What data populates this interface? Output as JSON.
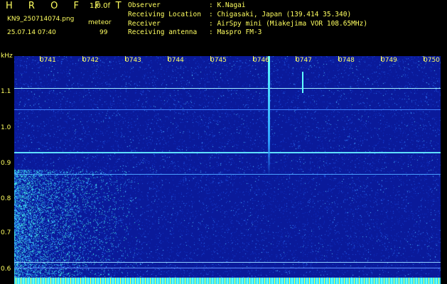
{
  "header": {
    "title": "H R O F F T",
    "version": "1.0.0f",
    "filename": "KN9_250714074.png",
    "mode": "meteor",
    "datetime": "25.07.14 07:40",
    "count": "99",
    "info_rows": [
      {
        "key": "Observer",
        "value": ": K.Nagai"
      },
      {
        "key": "Receiving Location",
        "value": ": Chigasaki, Japan (139.414 35.340)"
      },
      {
        "key": "Receiver",
        "value": ": AirSpy mini (Miakejima VOR 108.65MHz)"
      },
      {
        "key": "Receiving antenna",
        "value": ": Maspro FM-3"
      }
    ]
  },
  "axis": {
    "unit": "kHz",
    "y_ticks": [
      "1.1",
      "1.0",
      "0.9",
      "0.8",
      "0.7",
      "0.6"
    ],
    "x_ticks": [
      "0741",
      "0742",
      "0743",
      "0744",
      "0745",
      "0746",
      "0747",
      "0748",
      "0749",
      "0750"
    ]
  },
  "colors": {
    "background": "#000000",
    "text": "#ffff60",
    "spectrogram": "#0a1a9a",
    "signal": "#30e0ff"
  }
}
